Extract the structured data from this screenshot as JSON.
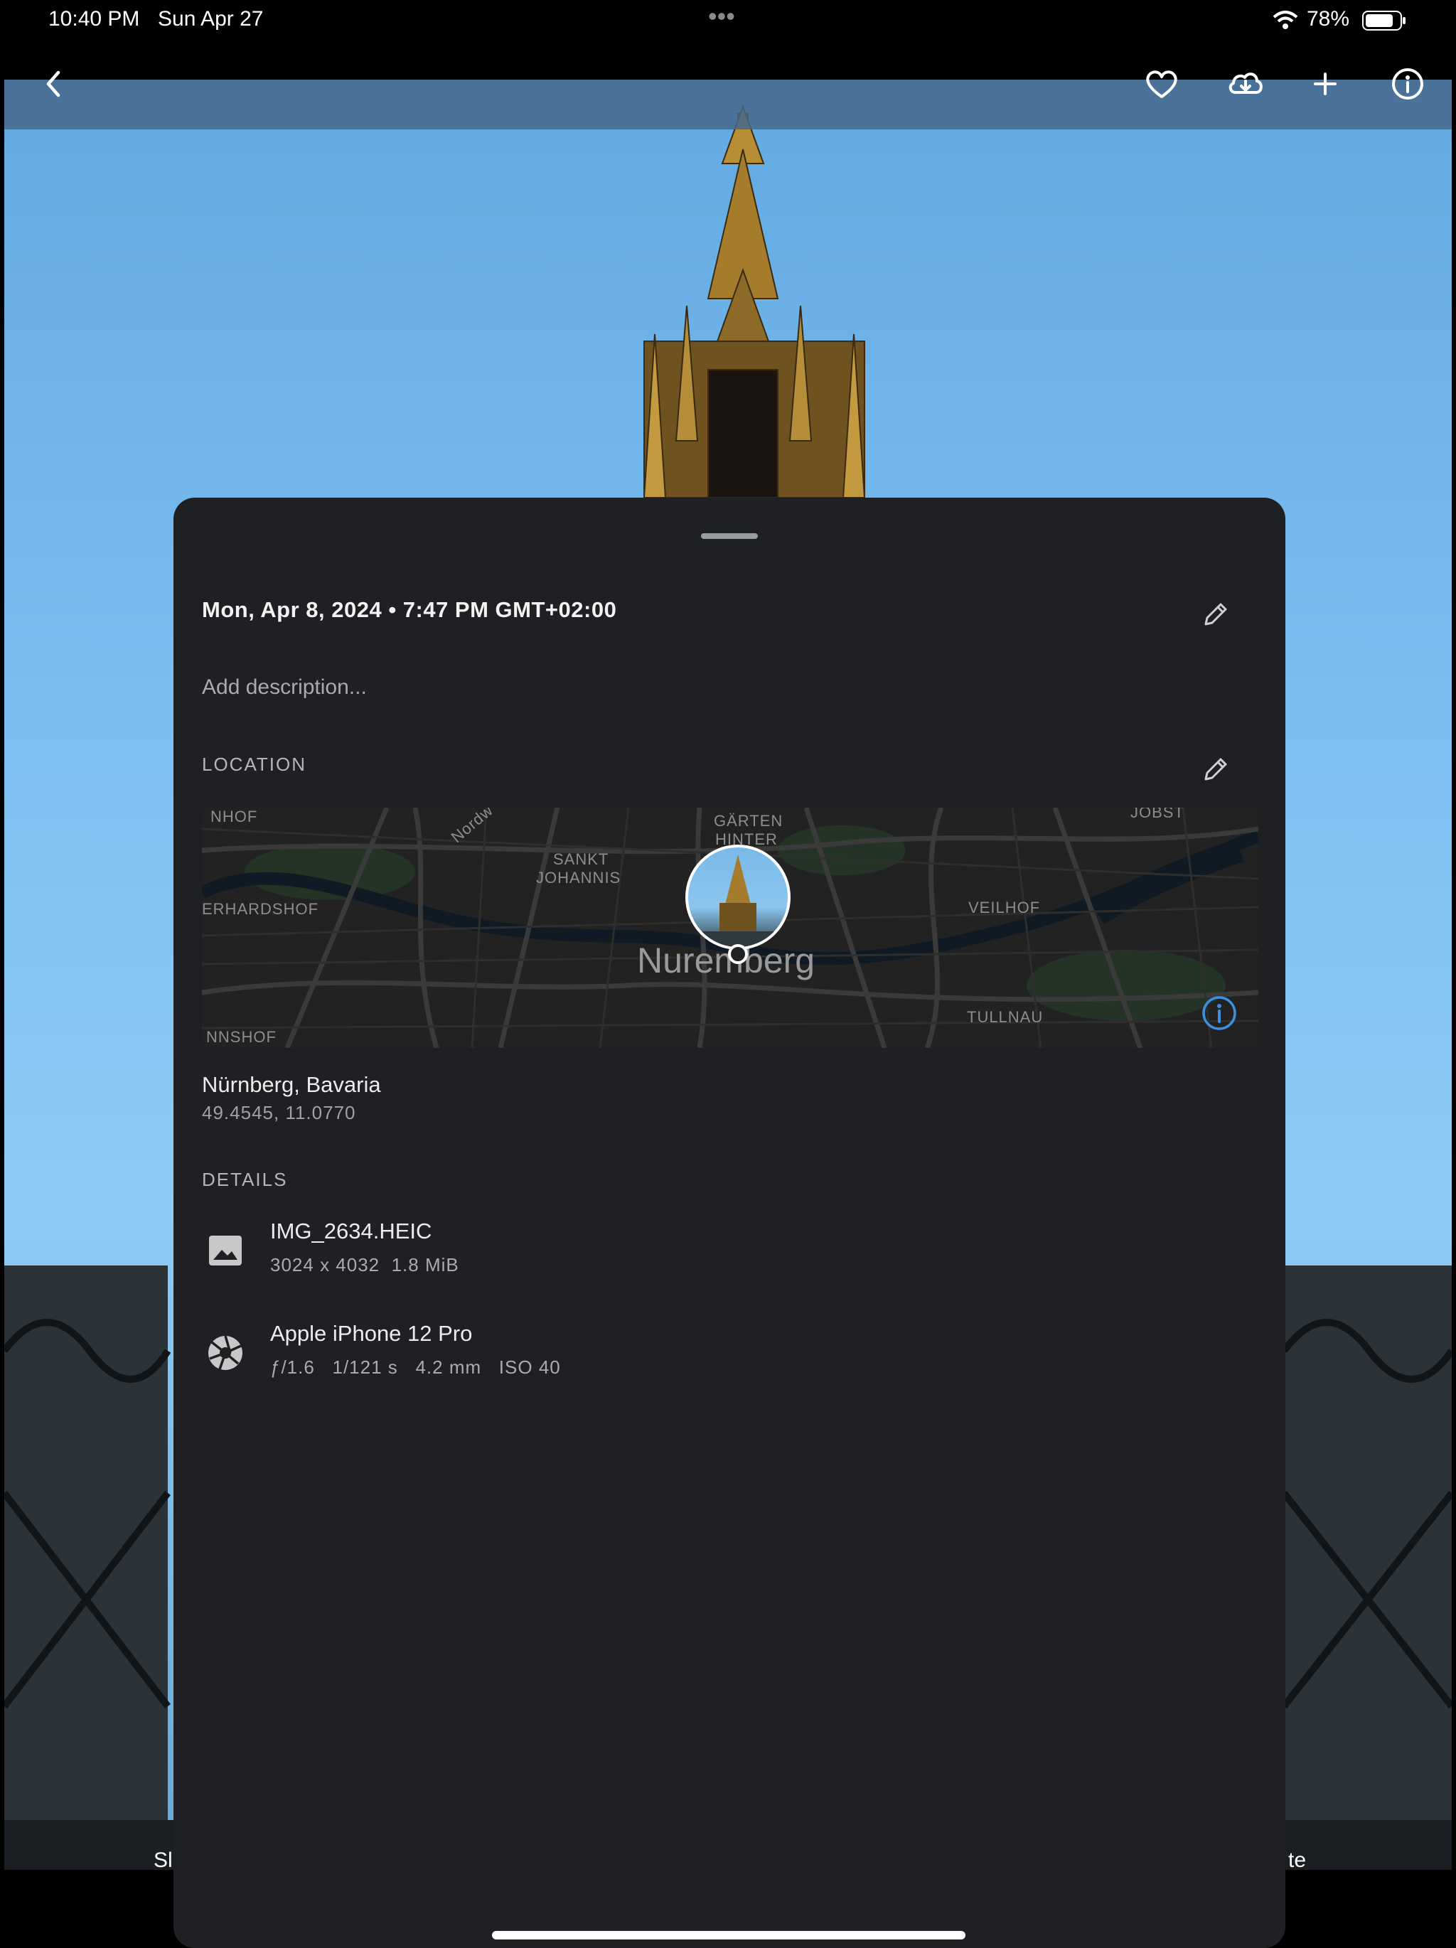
{
  "status_bar": {
    "time": "10:40 PM",
    "date": "Sun Apr 27",
    "more_indicator": "•••",
    "battery": "78%",
    "wifi_icon": "wifi-icon",
    "battery_icon": "battery-icon"
  },
  "toolbar": {
    "back_icon": "chevron-left-icon",
    "favorite_icon": "heart-icon",
    "download_icon": "cloud-download-icon",
    "add_icon": "plus-icon",
    "info_icon": "info-icon"
  },
  "background_photo": {
    "partial_left_text": "Sl",
    "partial_right_text": "te"
  },
  "info_sheet": {
    "datetime": "Mon, Apr 8, 2024 • 7:47 PM GMT+02:00",
    "description_placeholder": "Add description...",
    "location_header": "LOCATION",
    "map": {
      "city_label": "Nuremberg",
      "district_labels": [
        "NHOF",
        "GÄRTEN",
        "HINTER",
        "SANKT",
        "JOHANNIS",
        "ERHARDSHOF",
        "VEILHOF",
        "NNSHOF",
        "TULLNAU",
        "JOBST",
        "Nordw"
      ]
    },
    "place_name": "Nürnberg, Bavaria",
    "coordinates": "49.4545, 11.0770",
    "details_header": "DETAILS",
    "file": {
      "name": "IMG_2634.HEIC",
      "meta": "3024 x 4032  1.8 MiB",
      "icon": "image-icon"
    },
    "camera": {
      "model": "Apple iPhone 12 Pro",
      "meta": "ƒ/1.6   1/121 s   4.2 mm   ISO 40",
      "icon": "aperture-icon"
    },
    "edit_icon": "pencil-icon"
  },
  "colors": {
    "sheet_background": "#1f2023",
    "accent_blue": "#3d8fe0",
    "sky_blue": "#78bdf0"
  }
}
